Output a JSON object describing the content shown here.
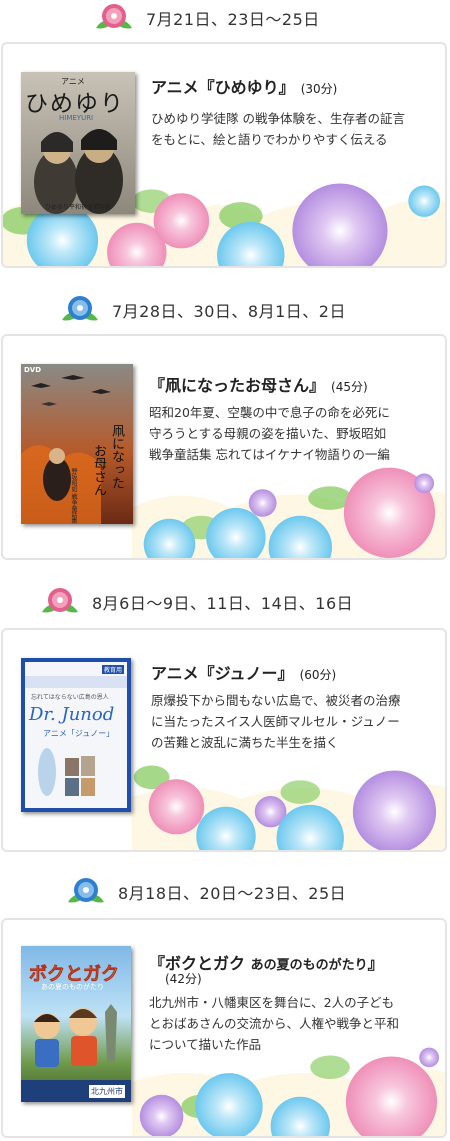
{
  "sections": [
    {
      "date": "7月21日、23日〜25日",
      "flower_color": "#e2608c",
      "title": "アニメ『ひめゆり』",
      "duration": "(30分)",
      "description_lines": [
        "ひめゆり学徒隊 の戦争体験を、生存者の証言",
        "をもとに、絵と語りでわかりやすく伝える"
      ],
      "cover": {
        "kicker": "アニメ",
        "main": "ひめゆり",
        "roman": "HIMEYURI",
        "caption": "ひめゆり平和祈念資料館"
      }
    },
    {
      "date": "7月28日、30日、8月1日、2日",
      "flower_color": "#2f7fcf",
      "title": "『凧になったお母さん』",
      "duration": "(45分)",
      "description_lines": [
        "昭和20年夏、空襲の中で息子の命を必死に",
        "守ろうとする母親の姿を描いた、野坂昭如",
        "戦争童話集 忘れてはイケナイ物語りの一編"
      ],
      "cover": {
        "dvd": "DVD",
        "main_a": "凧になった",
        "main_b": "お母さん",
        "author": "野坂昭如 戦争童話集"
      }
    },
    {
      "date": "8月6日〜9日、11日、14日、16日",
      "flower_color": "#e2608c",
      "title": "アニメ『ジュノー』",
      "duration": "(60分)",
      "description_lines": [
        "原爆投下から間もない広島で、被災者の治療",
        "に当たったスイス人医師マルセル・ジュノー",
        "の苦難と波乱に満ちた半生を描く"
      ],
      "cover": {
        "badge": "教育用",
        "kicker": "忘れてはならない広島の恩人",
        "main": "Dr. Junod",
        "sub": "アニメ「ジュノー」"
      }
    },
    {
      "date": "8月18日、20日〜23日、25日",
      "flower_color": "#2f7fcf",
      "title": "『ボクとガク",
      "title_sub": "あの夏のものがたり",
      "title_end": "』",
      "duration": "(42分)",
      "description_lines": [
        "北九州市・八幡東区を舞台に、2人の子ども",
        "とおばあさんの交流から、人権や戦争と平和",
        "について描いた作品"
      ],
      "cover": {
        "main": "ボクとガク",
        "sub": "あの夏のものがたり",
        "city": "北九州市"
      }
    }
  ]
}
